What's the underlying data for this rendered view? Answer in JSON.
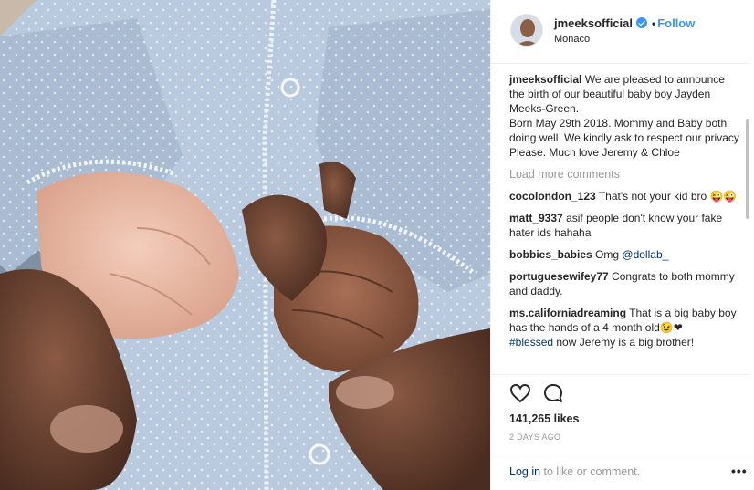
{
  "header": {
    "username": "jmeeksofficial",
    "follow_label": "Follow",
    "dot": "•",
    "location": "Monaco"
  },
  "caption": {
    "username": "jmeeksofficial",
    "text": "We are pleased to announce the birth of our beautiful baby boy Jayden Meeks-Green.",
    "line2": "Born May 29th 2018. Mommy and Baby both doing well. We kindly ask to respect our privacy",
    "line3": "Please. Much love Jeremy & Chloe"
  },
  "load_more": "Load more comments",
  "comments": [
    {
      "user": "cocolondon_123",
      "text": "That's not your kid bro 😜😜"
    },
    {
      "user": "matt_9337",
      "text": "asif people don't know your fake hater ids hahaha"
    },
    {
      "user": "bobbies_babies",
      "text": "Omg",
      "mention": "@dollab_"
    },
    {
      "user": "portuguesewifey77",
      "text": "Congrats to both mommy and daddy."
    },
    {
      "user": "ms.californiadreaming",
      "text": "That is a big baby boy has the hands of a 4 month old😉❤",
      "hashtag": "#blessed",
      "text_after": " now Jeremy is a big brother!"
    }
  ],
  "likes": "141,265 likes",
  "posted": "2 DAYS AGO",
  "footer": {
    "login_link": "Log in",
    "login_rest": " to like or comment.",
    "more": "•••"
  },
  "icons": {
    "like": "heart-outline-icon",
    "comment": "speech-bubble-icon",
    "verified": "verified-badge-icon",
    "more": "more-options-icon"
  },
  "colors": {
    "link_blue": "#3897f0",
    "dark_link": "#003569",
    "muted": "#999999",
    "text": "#262626",
    "onesie": "#b7c8dc"
  }
}
